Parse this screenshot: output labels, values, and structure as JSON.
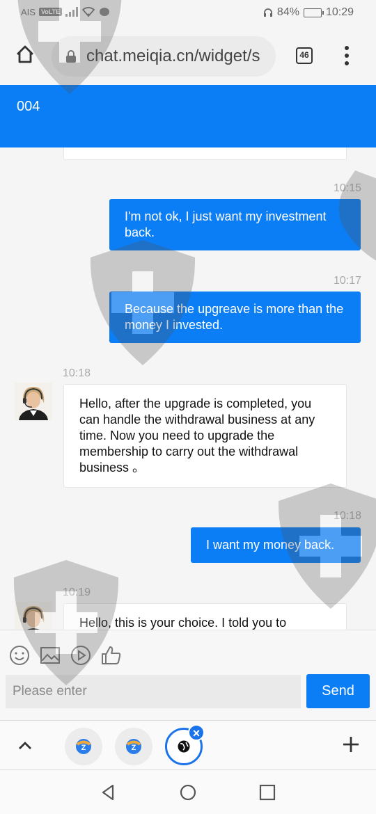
{
  "status_bar": {
    "carrier": "AIS",
    "volte": "VoLTE",
    "battery": "84%",
    "battery_level": 0.84,
    "time": "10:29"
  },
  "browser": {
    "url": "chat.meiqia.cn/widget/s",
    "tab_count": "46"
  },
  "chat": {
    "title": "004",
    "messages": [
      {
        "direction": "out",
        "time": "10:15",
        "text": "I'm not ok, I just want my investment back."
      },
      {
        "direction": "out",
        "time": "10:17",
        "text": "Because the upgreave is more than the money I invested."
      },
      {
        "direction": "in",
        "time": "10:18",
        "text": "Hello, after the upgrade is completed, you can handle the withdrawal business at any time. Now you need to upgrade the membership to carry out the withdrawal business 。"
      },
      {
        "direction": "out",
        "time": "10:18",
        "text": "I want my money back."
      },
      {
        "direction": "in",
        "time": "10:19",
        "text": "Hello, this is your choice. I told you to"
      }
    ]
  },
  "composer": {
    "placeholder": "Please enter",
    "value": "",
    "send_label": "Send",
    "tools": [
      "emoji-icon",
      "image-icon",
      "video-icon",
      "thumbs-up-icon"
    ]
  },
  "tab_strip": {
    "tabs": [
      "app-tab-icon",
      "app-tab-icon",
      "globe-tab-icon"
    ],
    "close_symbol": "×"
  },
  "colors": {
    "accent": "#0b7df5",
    "watermark": "#555555"
  }
}
